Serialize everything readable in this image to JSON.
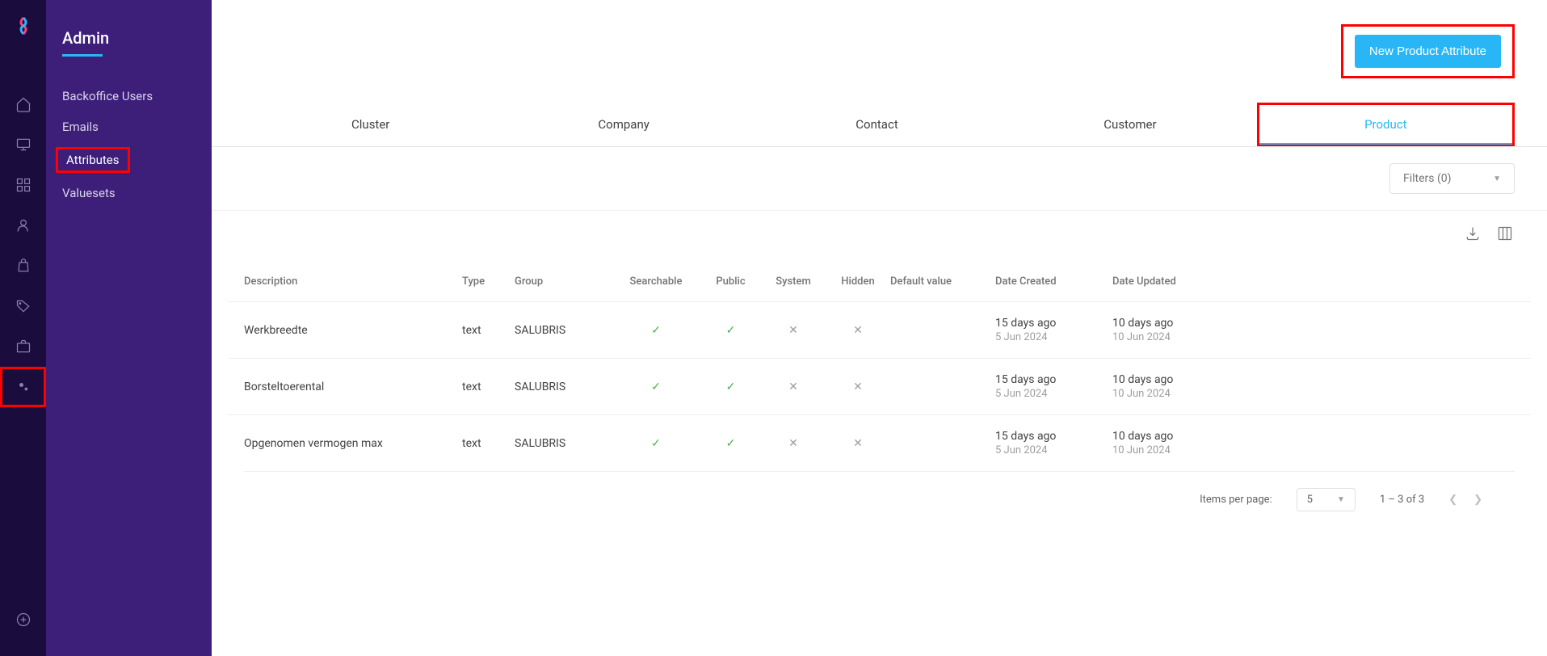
{
  "sidebar": {
    "title": "Admin",
    "items": [
      {
        "label": "Backoffice Users"
      },
      {
        "label": "Emails"
      },
      {
        "label": "Attributes"
      },
      {
        "label": "Valuesets"
      }
    ]
  },
  "header": {
    "new_button": "New Product Attribute"
  },
  "tabs": [
    {
      "label": "Cluster"
    },
    {
      "label": "Company"
    },
    {
      "label": "Contact"
    },
    {
      "label": "Customer"
    },
    {
      "label": "Product"
    }
  ],
  "filters": {
    "label": "Filters (0)"
  },
  "table": {
    "columns": [
      "Description",
      "Type",
      "Group",
      "Searchable",
      "Public",
      "System",
      "Hidden",
      "Default value",
      "Date Created",
      "Date Updated"
    ],
    "rows": [
      {
        "description": "Werkbreedte",
        "type": "text",
        "group": "SALUBRIS",
        "searchable": true,
        "public": true,
        "system": false,
        "hidden": false,
        "default_value": "",
        "created_rel": "15 days ago",
        "created_date": "5 Jun 2024",
        "updated_rel": "10 days ago",
        "updated_date": "10 Jun 2024"
      },
      {
        "description": "Borsteltoerental",
        "type": "text",
        "group": "SALUBRIS",
        "searchable": true,
        "public": true,
        "system": false,
        "hidden": false,
        "default_value": "",
        "created_rel": "15 days ago",
        "created_date": "5 Jun 2024",
        "updated_rel": "10 days ago",
        "updated_date": "10 Jun 2024"
      },
      {
        "description": "Opgenomen vermogen max",
        "type": "text",
        "group": "SALUBRIS",
        "searchable": true,
        "public": true,
        "system": false,
        "hidden": false,
        "default_value": "",
        "created_rel": "15 days ago",
        "created_date": "5 Jun 2024",
        "updated_rel": "10 days ago",
        "updated_date": "10 Jun 2024"
      }
    ]
  },
  "pagination": {
    "items_label": "Items per page:",
    "page_size": "5",
    "range": "1 – 3 of 3"
  }
}
